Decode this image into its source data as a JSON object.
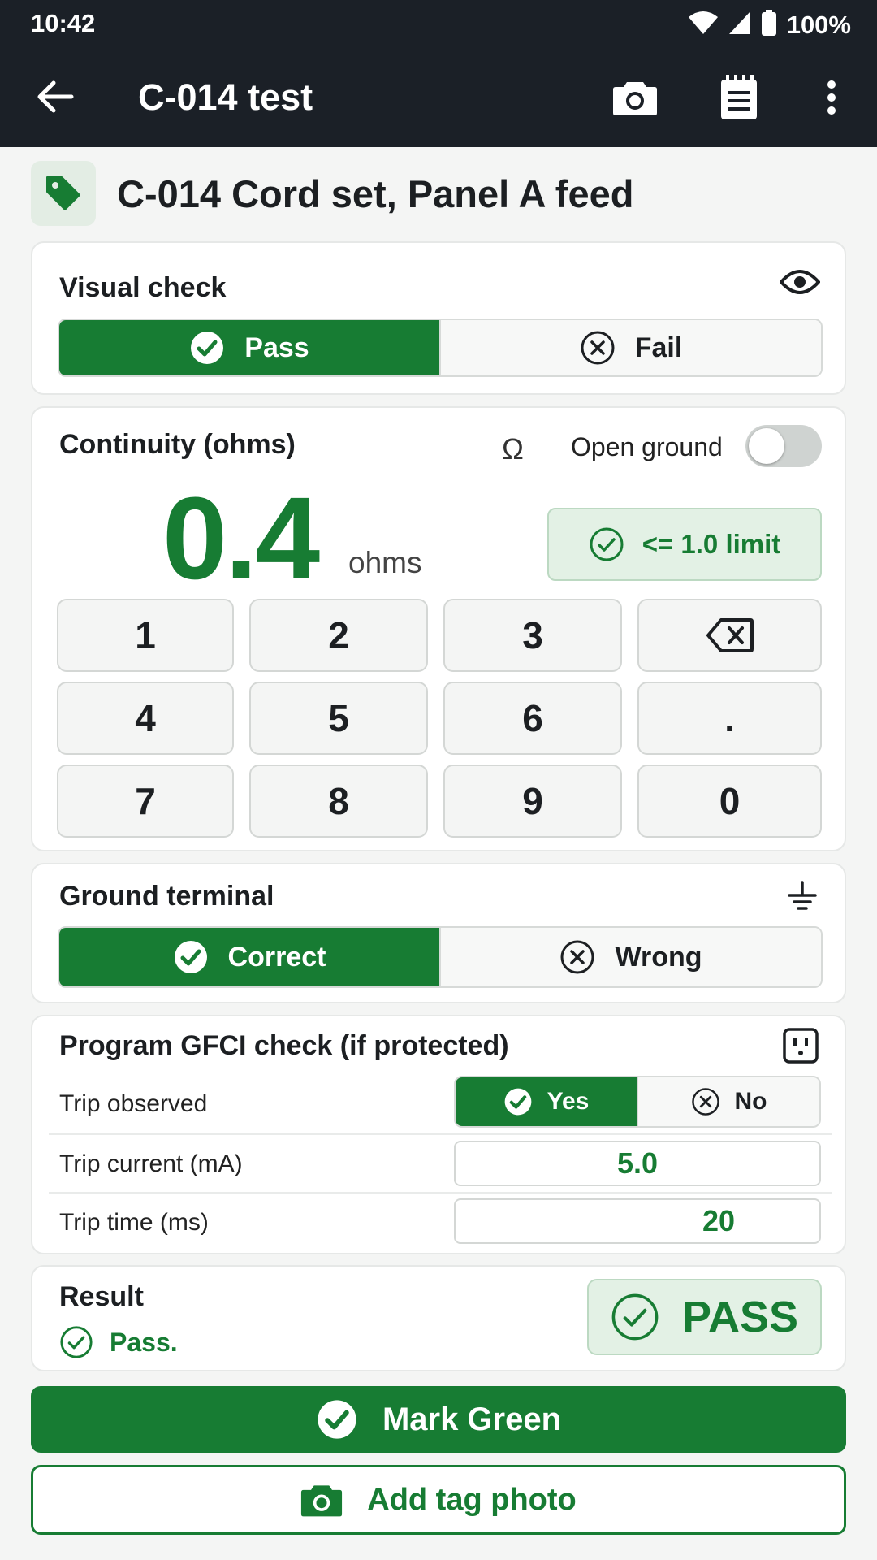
{
  "status_bar": {
    "time": "10:42",
    "battery": "100%"
  },
  "app_bar": {
    "title": "C-014 test"
  },
  "asset": {
    "title": "C-014 Cord set, Panel A feed"
  },
  "visual_check": {
    "title": "Visual check",
    "pass_label": "Pass",
    "fail_label": "Fail",
    "selected": "Pass"
  },
  "continuity": {
    "title": "Continuity (ohms)",
    "omega": "Ω",
    "open_ground_label": "Open ground",
    "open_ground_on": false,
    "value": "0.4",
    "unit": "ohms",
    "limit_label": "<= 1.0 limit",
    "keys": [
      "1",
      "2",
      "3",
      "4",
      "5",
      "6",
      ".",
      "7",
      "8",
      "9",
      "0"
    ]
  },
  "ground_terminal": {
    "title": "Ground terminal",
    "correct_label": "Correct",
    "wrong_label": "Wrong",
    "selected": "Correct"
  },
  "gfci": {
    "title": "Program GFCI check (if protected)",
    "trip_observed_label": "Trip observed",
    "yes_label": "Yes",
    "no_label": "No",
    "selected": "Yes",
    "trip_current_label": "Trip current (mA)",
    "trip_current_value": "5.0",
    "trip_time_label": "Trip time (ms)",
    "trip_time_value": "20"
  },
  "result": {
    "title": "Result",
    "summary": "Pass.",
    "badge": "PASS"
  },
  "actions": {
    "mark_green": "Mark Green",
    "add_tag_photo": "Add tag photo"
  },
  "colors": {
    "accent": "#177c33",
    "app_bar": "#1b2027",
    "success_bg": "#e3f1e5"
  }
}
